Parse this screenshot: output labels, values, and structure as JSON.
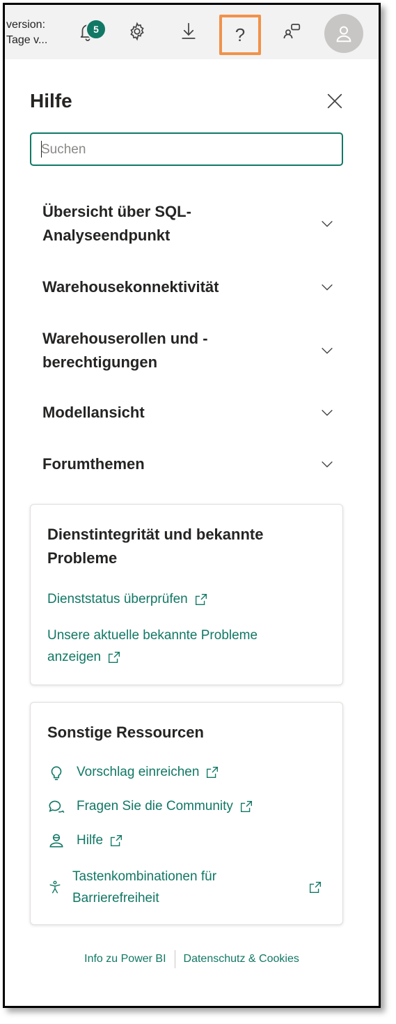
{
  "topbar": {
    "version_line1": "version:",
    "version_line2": "Tage v...",
    "notification_count": "5",
    "help_glyph": "?"
  },
  "panel": {
    "title": "Hilfe",
    "search_placeholder": "Suchen",
    "sections": [
      {
        "line1": "Übersicht über SQL-",
        "line2": "Analyseendpunkt"
      },
      {
        "line1": "Warehousekonnektivität",
        "line2": ""
      },
      {
        "line1": "Warehouserollen und -",
        "line2": "berechtigungen"
      },
      {
        "line1": "Modellansicht",
        "line2": ""
      },
      {
        "line1": "Forumthemen",
        "line2": ""
      }
    ]
  },
  "service_card": {
    "title_line1": "Dienstintegrität und bekannte",
    "title_line2": "Probleme",
    "link1": "Dienststatus überprüfen",
    "link2_line1": "Unsere aktuelle bekannte Probleme",
    "link2_line2": "anzeigen"
  },
  "resources_card": {
    "title": "Sonstige Ressourcen",
    "items": [
      {
        "label": "Vorschlag einreichen",
        "icon": "lightbulb-icon"
      },
      {
        "label": "Fragen Sie die Community",
        "icon": "chat-icon"
      },
      {
        "label": "Hilfe",
        "icon": "support-icon"
      },
      {
        "label_line1": "Tastenkombinationen für",
        "label_line2": "Barrierefreiheit",
        "icon": "accessibility-icon"
      }
    ]
  },
  "footer": {
    "link1": "Info zu Power BI",
    "link2": "Datenschutz & Cookies"
  },
  "colors": {
    "accent": "#117865",
    "highlight": "#f0924a",
    "topbar_bg": "#f2f2f2"
  }
}
